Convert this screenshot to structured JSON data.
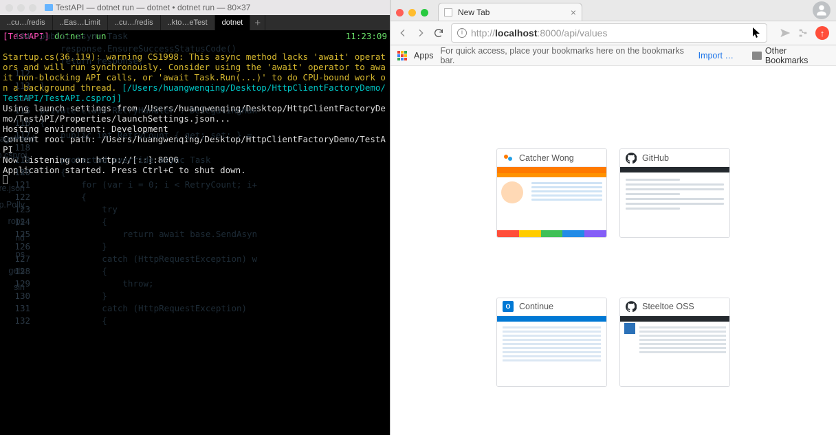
{
  "terminal": {
    "title": "TestAPI — dotnet run — dotnet • dotnet run — 80×37",
    "tabs": [
      "..cu…/redis",
      "..Eas…Limit",
      "..cu…/redis",
      "..kto…eTest",
      "dotnet"
    ],
    "active_tab": 4,
    "prompt_project": "[TestAPI]",
    "prompt_cmd": "dotnet run",
    "clock": "11:23:09",
    "warn_text": "Startup.cs(36,119): warning CS1998: This async method lacks 'await' operators and will run synchronously. Consider using the 'await' operator to await non-blocking API calls, or 'await Task.Run(...)' to do CPU-bound work on a background thread.",
    "warn_path": "[/Users/huangwenqing/Desktop/HttpClientFactoryDemo/TestAPI/TestAPI.csproj]",
    "out1": "Using launch settings from /Users/huangwenqing/Desktop/HttpClientFactoryDemo/TestAPI/Properties/launchSettings.json...",
    "out2": "Hosting environment: Development",
    "out3": "Content root path: /Users/huangwenqing/Desktop/HttpClientFactoryDemo/TestAPI",
    "out4": "Now listening on: http://[::]:8000",
    "out5": "Application started. Press Ctrl+C to shut down."
  },
  "bgcode": {
    "lines": [
      {
        "n": 104,
        "t": "public async Task<HttpRespo"
      },
      {
        "n": "",
        "t": ""
      },
      {
        "n": "",
        "t": "    response.EnsureSuccessStatusCode()"
      },
      {
        "n": "",
        "t": ""
      },
      {
        "n": "",
        "t": "    return response;"
      },
      {
        "n": 112,
        "t": ""
      },
      {
        "n": 113,
        "t": "}"
      },
      {
        "n": 114,
        "t": ""
      },
      {
        "n": 115,
        "t": "private class RetryHandler : DelegatingHan"
      },
      {
        "n": 116,
        "t": "{"
      },
      {
        "n": 117,
        "t": "    public int RetryCount { get; set; } ="
      },
      {
        "n": 118,
        "t": ""
      },
      {
        "n": 119,
        "t": "    protected override async Task<HttpResp"
      },
      {
        "n": 120,
        "t": "    {"
      },
      {
        "n": 121,
        "t": "        for (var i = 0; i < RetryCount; i+"
      },
      {
        "n": 122,
        "t": "        {"
      },
      {
        "n": 123,
        "t": "            try"
      },
      {
        "n": 124,
        "t": "            {"
      },
      {
        "n": 125,
        "t": "                return await base.SendAsyn"
      },
      {
        "n": 126,
        "t": "            }"
      },
      {
        "n": 127,
        "t": "            catch (HttpRequestException) w"
      },
      {
        "n": 128,
        "t": "            {"
      },
      {
        "n": 129,
        "t": "                throw;"
      },
      {
        "n": 130,
        "t": "            }"
      },
      {
        "n": 131,
        "t": "            catch (HttpRequestException)"
      },
      {
        "n": 132,
        "t": "            {"
      }
    ],
    "files": [
      "gHttpMessageHand",
      "nsions.Http.csproj",
      "x",
      "ore.json",
      "nsions.Http.Polly",
      "rops",
      "",
      "",
      "",
      "nd",
      "ps",
      "gets",
      "sln"
    ]
  },
  "chrome": {
    "tab_title": "New Tab",
    "url_host_dim1": "http://",
    "url_host_bold": "localhost",
    "url_host_dim2": ":8000/api/values",
    "bookmark_bar": {
      "apps_label": "Apps",
      "hint": "For quick access, place your bookmarks here on the bookmarks bar.",
      "import": "Import b…",
      "other": "Other Bookmarks"
    },
    "tiles": [
      {
        "title": "Catcher Wong",
        "fav": "cw"
      },
      {
        "title": "GitHub",
        "fav": "gh"
      },
      {
        "title": "Continue",
        "fav": "ol"
      },
      {
        "title": "Steeltoe OSS",
        "fav": "gh"
      }
    ]
  }
}
